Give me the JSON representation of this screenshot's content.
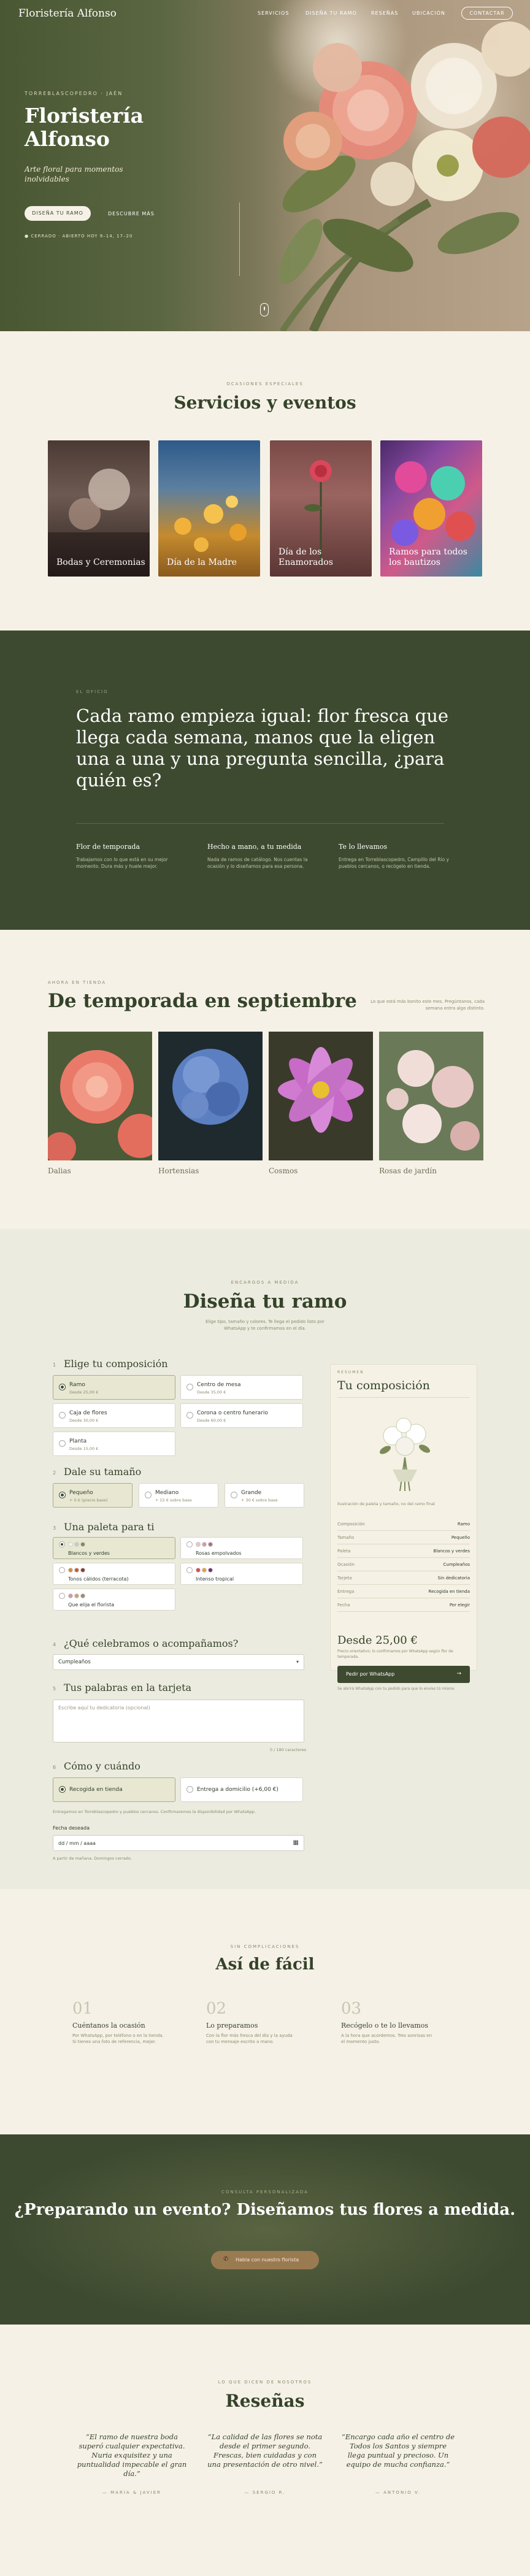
{
  "nav": {
    "brand": "Floristería Alfonso",
    "links": [
      "SERVICIOS",
      "DISEÑA TU RAMO",
      "RESEÑAS",
      "UBICACIÓN"
    ],
    "contact": "CONTACTAR"
  },
  "hero": {
    "kicker": "TORREBLASCOPEDRO · JAÉN",
    "title": "Floristería Alfonso",
    "subtitle": "Arte floral para momentos inolvidables",
    "primary_button": "DISEÑA TU RAMO",
    "secondary_link": "DESCUBRE MÁS",
    "info": "● CERRADO · ABIERTO HOY 9–14, 17–20"
  },
  "services": {
    "kicker": "OCASIONES ESPECIALES",
    "title": "Servicios y eventos",
    "items": [
      {
        "label": "Bodas y Ceremonias"
      },
      {
        "label": "Día de la Madre"
      },
      {
        "label": "Día de los Enamorados"
      },
      {
        "label": "Ramos para todos los bautizos"
      }
    ]
  },
  "manifesto": {
    "kicker": "EL OFICIO",
    "quote": "Cada ramo empieza igual: flor fresca que llega cada semana, manos que la eligen una a una y una pregunta sencilla, ¿para quién es?",
    "columns": [
      {
        "title": "Flor de temporada",
        "text": "Trabajamos con lo que está en su mejor momento. Dura más y huele mejor."
      },
      {
        "title": "Hecho a mano, a tu medida",
        "text": "Nada de ramos de catálogo. Nos cuentas la ocasión y lo diseñamos para esa persona."
      },
      {
        "title": "Te lo llevamos",
        "text": "Entrega en Torreblascopedro, Campillo del Río y pueblos cercanos, o recógelo en tienda."
      }
    ]
  },
  "season": {
    "kicker": "AHORA EN TIENDA",
    "title": "De temporada en septiembre",
    "note": "Lo que está más bonito este mes. Pregúntanos, cada semana entra algo distinto.",
    "items": [
      "Dalias",
      "Hortensias",
      "Cosmos",
      "Rosas de jardín"
    ]
  },
  "designer": {
    "kicker": "ENCARGOS A MEDIDA",
    "title": "Diseña tu ramo",
    "description": "Elige tipo, tamaño y colores. Te llega el pedido listo por WhatsApp y te confirmamos en el día.",
    "step1": {
      "num": "1",
      "title": "Elige tu composición",
      "options": [
        {
          "title": "Ramo",
          "sub": "Desde 25,00 €"
        },
        {
          "title": "Centro de mesa",
          "sub": "Desde 35,00 €"
        },
        {
          "title": "Caja de flores",
          "sub": "Desde 30,00 €"
        },
        {
          "title": "Corona o centro funerario",
          "sub": "Desde 60,00 €"
        },
        {
          "title": "Planta",
          "sub": "Desde 15,00 €"
        }
      ]
    },
    "step2": {
      "num": "2",
      "title": "Dale su tamaño",
      "options": [
        {
          "title": "Pequeño",
          "sub": "+ 0 € (precio base)"
        },
        {
          "title": "Mediano",
          "sub": "+ 15 € sobre base"
        },
        {
          "title": "Grande",
          "sub": "+ 30 € sobre base"
        }
      ]
    },
    "step3": {
      "num": "3",
      "title": "Una paleta para ti",
      "options": [
        {
          "title": "Blancos y verdes",
          "colors": [
            "#f4f2ea",
            "#c9cfae",
            "#7c8a5a"
          ]
        },
        {
          "title": "Rosas empolvados",
          "colors": [
            "#e9c6c4",
            "#d89a9a",
            "#b36f78"
          ]
        },
        {
          "title": "Tonos cálidos (terracota)",
          "colors": [
            "#d9863a",
            "#c35a35",
            "#8e3b26"
          ]
        },
        {
          "title": "Intenso tropical",
          "colors": [
            "#e0445a",
            "#e7a131",
            "#7b2a72"
          ]
        },
        {
          "title": "Que elija el florista",
          "colors": [
            "#c89aa6",
            "#c8a670",
            "#9a8c6a"
          ]
        }
      ]
    },
    "step4": {
      "num": "4",
      "title": "¿Qué celebramos o acompañamos?",
      "value": "Cumpleaños"
    },
    "step5": {
      "num": "5",
      "title": "Tus palabras en la tarjeta",
      "placeholder": "Escribe aquí tu dedicatoria (opcional)",
      "count": "0 / 180 caracteres"
    },
    "step6": {
      "num": "6",
      "title": "Cómo y cuándo",
      "options": [
        {
          "title": "Recogida en tienda"
        },
        {
          "title": "Entrega a domicilio (+6,00 €)"
        }
      ],
      "note": "Entregamos en Torreblascopedro y pueblos cercanos. Confirmaremos la disponibilidad por WhatsApp.",
      "date_label": "Fecha deseada",
      "date_value": "dd / mm / aaaa",
      "date_help": "A partir de mañana. Domingos cerrado."
    }
  },
  "summary": {
    "kicker": "RESUMEN",
    "title": "Tu composición",
    "caption": "Ilustración de paleta y tamaño, no del ramo final",
    "rows": [
      {
        "k": "Composición",
        "v": "Ramo"
      },
      {
        "k": "Tamaño",
        "v": "Pequeño"
      },
      {
        "k": "Paleta",
        "v": "Blancos y verdes"
      },
      {
        "k": "Ocasión",
        "v": "Cumpleaños"
      },
      {
        "k": "Tarjeta",
        "v": "Sin dedicatoria"
      },
      {
        "k": "Entrega",
        "v": "Recogida en tienda"
      },
      {
        "k": "Fecha",
        "v": "Por elegir"
      }
    ],
    "price": "Desde 25,00 €",
    "price_note": "Precio orientativo; lo confirmamos por WhatsApp según flor de temporada.",
    "button": "Pedir por WhatsApp",
    "footer": "Se abrirá WhatsApp con tu pedido para que lo envíes tú mismo."
  },
  "how": {
    "kicker": "SIN COMPLICACIONES",
    "title": "Así de fácil",
    "steps": [
      {
        "num": "01",
        "title": "Cuéntanos la ocasión",
        "text": "Por WhatsApp, por teléfono o en la tienda. Si tienes una foto de referencia, mejor."
      },
      {
        "num": "02",
        "title": "Lo preparamos",
        "text": "Con la flor más fresca del día y la ayuda con tu mensaje escrito a mano."
      },
      {
        "num": "03",
        "title": "Recógelo o te lo llevamos",
        "text": "A la hora que acordemos. Tres sonrisas en el momento justo."
      }
    ]
  },
  "cta": {
    "kicker": "CONSULTA PERSONALIZADA",
    "title": "¿Preparando un evento? Diseñamos tus flores a medida.",
    "button": "Habla con nuestro florista"
  },
  "reviews": {
    "kicker": "LO QUE DICEN DE NOSOTROS",
    "title": "Reseñas",
    "items": [
      {
        "text": "“El ramo de nuestra boda superó cualquier expectativa. Nuria exquisitez y una puntualidad impecable el gran día.”",
        "author": "— MARÍA & JAVIER"
      },
      {
        "text": "“La calidad de las flores se nota desde el primer segundo. Frescas, bien cuidadas y con una presentación de otro nivel.”",
        "author": "— SERGIO R."
      },
      {
        "text": "“Encargo cada año el centro de Todos los Santos y siempre llega puntual y precioso. Un equipo de mucha confianza.”",
        "author": "— ANTONIO V."
      }
    ]
  }
}
